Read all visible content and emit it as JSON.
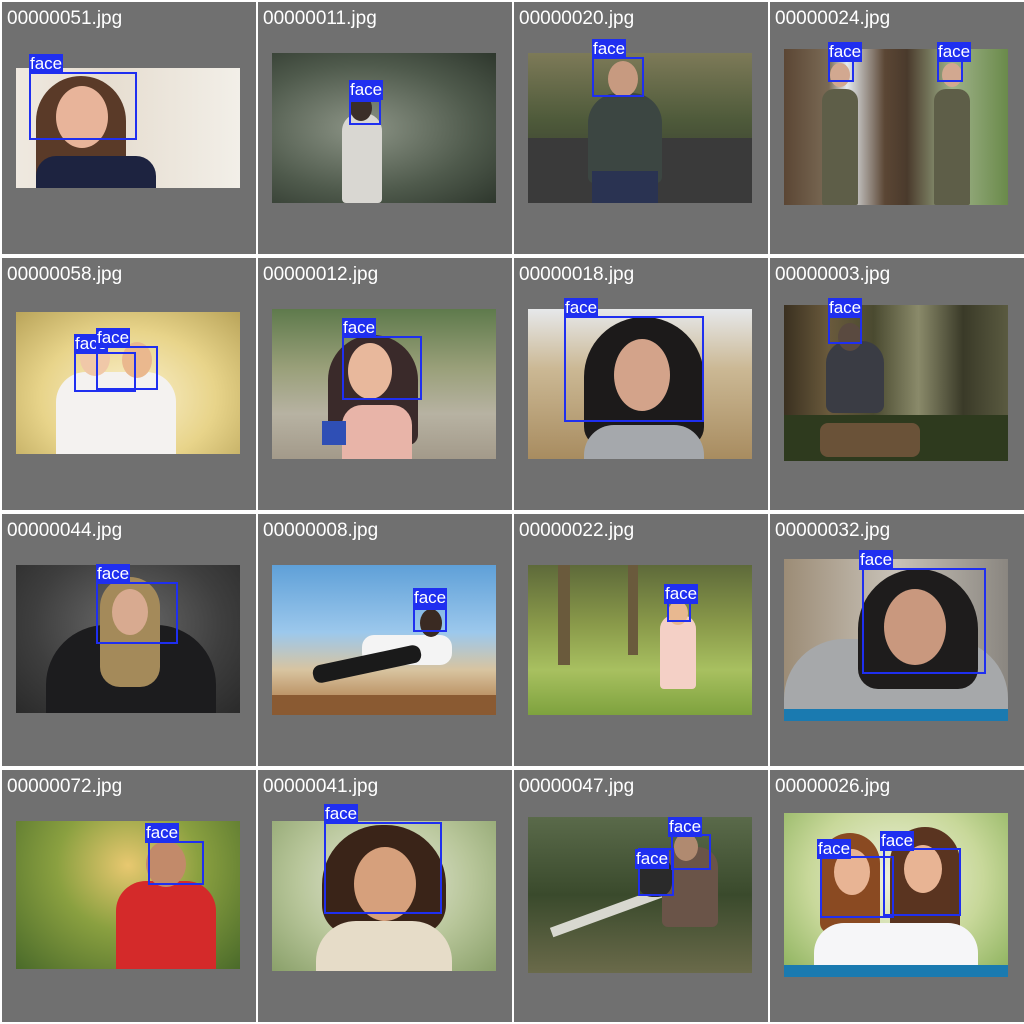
{
  "colors": {
    "cell_bg": "#707070",
    "box": "#1f2ff0",
    "label_text": "#ffffff"
  },
  "grid": {
    "cells": [
      {
        "filename": "00000051.jpg",
        "detections": [
          {
            "label": "face"
          }
        ]
      },
      {
        "filename": "00000011.jpg",
        "detections": [
          {
            "label": "face"
          }
        ]
      },
      {
        "filename": "00000020.jpg",
        "detections": [
          {
            "label": "face"
          }
        ]
      },
      {
        "filename": "00000024.jpg",
        "detections": [
          {
            "label": "face"
          },
          {
            "label": "face"
          }
        ]
      },
      {
        "filename": "00000058.jpg",
        "detections": [
          {
            "label": "face"
          },
          {
            "label": "face"
          }
        ]
      },
      {
        "filename": "00000012.jpg",
        "detections": [
          {
            "label": "face"
          }
        ]
      },
      {
        "filename": "00000018.jpg",
        "detections": [
          {
            "label": "face"
          }
        ]
      },
      {
        "filename": "00000003.jpg",
        "detections": [
          {
            "label": "face"
          }
        ]
      },
      {
        "filename": "00000044.jpg",
        "detections": [
          {
            "label": "face"
          }
        ]
      },
      {
        "filename": "00000008.jpg",
        "detections": [
          {
            "label": "face"
          }
        ]
      },
      {
        "filename": "00000022.jpg",
        "detections": [
          {
            "label": "face"
          }
        ]
      },
      {
        "filename": "00000032.jpg",
        "detections": [
          {
            "label": "face"
          }
        ]
      },
      {
        "filename": "00000072.jpg",
        "detections": [
          {
            "label": "face"
          }
        ]
      },
      {
        "filename": "00000041.jpg",
        "detections": [
          {
            "label": "face"
          }
        ]
      },
      {
        "filename": "00000047.jpg",
        "detections": [
          {
            "label": "face"
          },
          {
            "label": "face"
          }
        ]
      },
      {
        "filename": "00000026.jpg",
        "detections": [
          {
            "label": "face"
          },
          {
            "label": "face"
          }
        ]
      }
    ]
  }
}
